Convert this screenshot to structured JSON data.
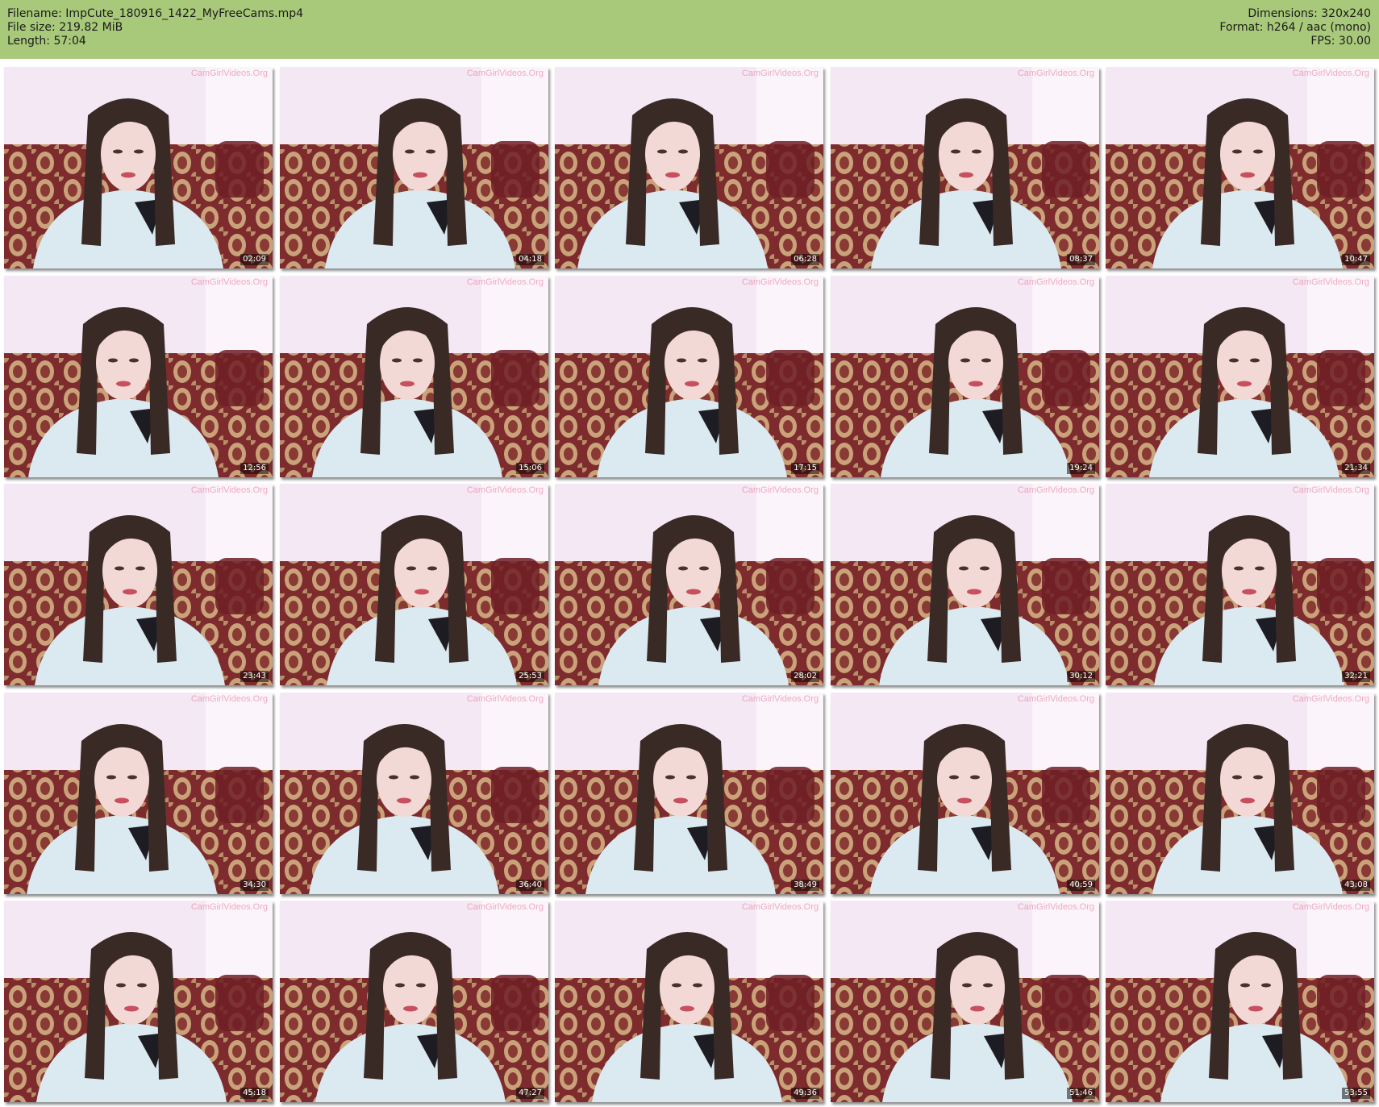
{
  "header": {
    "filename": "Filename: ImpCute_180916_1422_MyFreeCams.mp4",
    "file_size": "File size: 219.82 MiB",
    "length": "Length: 57:04",
    "dimensions": "Dimensions: 320x240",
    "format": "Format: h264 / aac (mono)",
    "fps": "FPS: 30.00",
    "background_color": "#a9c97a"
  },
  "watermark": "CamGirlVideos.Org",
  "thumbnails": [
    {
      "timestamp": "02:09"
    },
    {
      "timestamp": "04:18"
    },
    {
      "timestamp": "06:28"
    },
    {
      "timestamp": "08:37"
    },
    {
      "timestamp": "10:47"
    },
    {
      "timestamp": "12:56"
    },
    {
      "timestamp": "15:06"
    },
    {
      "timestamp": "17:15"
    },
    {
      "timestamp": "19:24"
    },
    {
      "timestamp": "21:34"
    },
    {
      "timestamp": "23:43"
    },
    {
      "timestamp": "25:53"
    },
    {
      "timestamp": "28:02"
    },
    {
      "timestamp": "30:12"
    },
    {
      "timestamp": "32:21"
    },
    {
      "timestamp": "34:30"
    },
    {
      "timestamp": "36:40"
    },
    {
      "timestamp": "38:49"
    },
    {
      "timestamp": "40:59"
    },
    {
      "timestamp": "43:08"
    },
    {
      "timestamp": "45:18"
    },
    {
      "timestamp": "47:27"
    },
    {
      "timestamp": "49:36"
    },
    {
      "timestamp": "51:46"
    },
    {
      "timestamp": "53:55"
    }
  ]
}
